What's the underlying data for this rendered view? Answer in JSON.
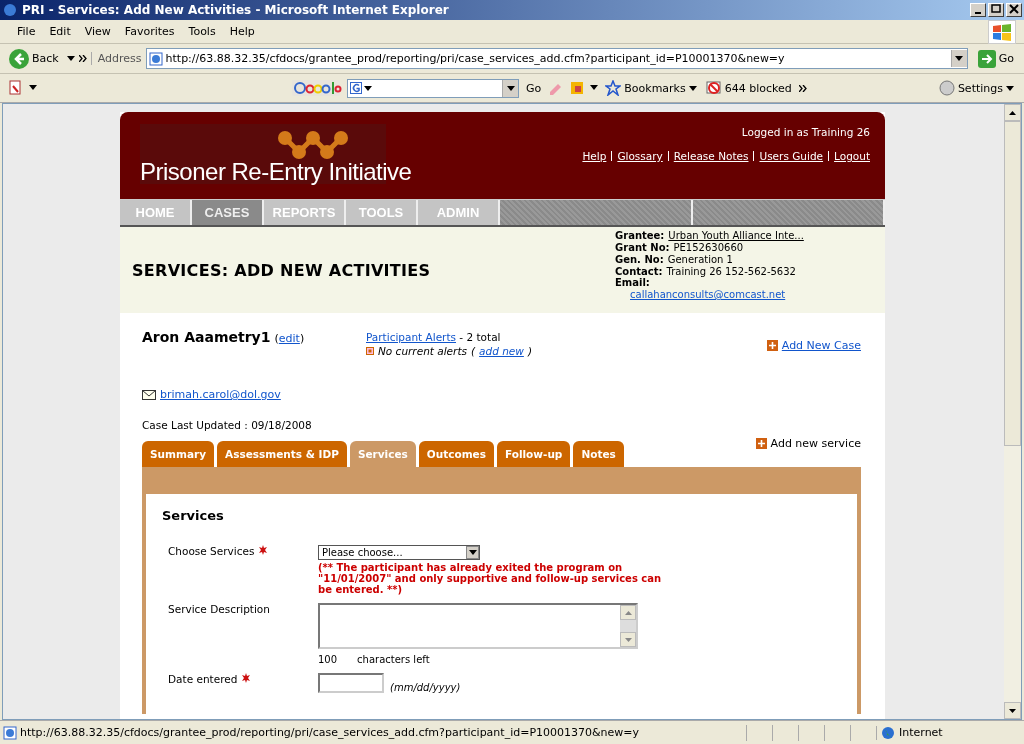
{
  "window": {
    "title": "PRI - Services: Add New Activities - Microsoft Internet Explorer"
  },
  "menu_bar": [
    "File",
    "Edit",
    "View",
    "Favorites",
    "Tools",
    "Help"
  ],
  "address_bar": {
    "back": "Back",
    "label": "Address",
    "url": "http://63.88.32.35/cfdocs/grantee_prod/reporting/pri/case_services_add.cfm?participant_id=P10001370&new=y",
    "go": "Go"
  },
  "google_toolbar": {
    "go": "Go",
    "bookmarks": "Bookmarks",
    "blocked": "644 blocked",
    "settings": "Settings"
  },
  "page": {
    "logo_text": "Prisoner Re-Entry Initiative",
    "logged_in": "Logged in as Training 26",
    "header_links": [
      "Help",
      "Glossary",
      "Release Notes",
      "Users Guide",
      "Logout"
    ],
    "nav_tabs": [
      {
        "label": "HOME",
        "selected": false
      },
      {
        "label": "CASES",
        "selected": true
      },
      {
        "label": "REPORTS",
        "selected": false
      },
      {
        "label": "TOOLS",
        "selected": false
      },
      {
        "label": "ADMIN",
        "selected": false
      }
    ],
    "heading": "SERVICES: ADD NEW ACTIVITIES",
    "grant_info": [
      {
        "label": "Grantee:",
        "value": "Urban Youth Alliance Inte...",
        "kind": "link"
      },
      {
        "label": "Grant No:",
        "value": "PE152630660",
        "kind": "text"
      },
      {
        "label": "Gen. No:",
        "value": "Generation 1",
        "kind": "text"
      },
      {
        "label": "Contact:",
        "value": "Training 26  152-562-5632",
        "kind": "text"
      },
      {
        "label": "Email:",
        "value": "callahanconsults@comcast.net",
        "kind": "email"
      }
    ],
    "participant": {
      "name": "Aron Aaametry1",
      "edit_open": "(",
      "edit": "edit",
      "edit_close": ")",
      "alerts_link": "Participant Alerts",
      "alerts_total": "- 2 total",
      "no_alerts": "No current alerts",
      "add_new_open": "(",
      "add_new": "add new",
      "add_new_close": ")",
      "add_case": "Add New Case",
      "email": "brimah.carol@dol.gov",
      "last_updated": "Case Last Updated : 09/18/2008"
    },
    "case_tabs": [
      {
        "label": "Summary",
        "selected": false
      },
      {
        "label": "Assessments & IDP",
        "selected": false
      },
      {
        "label": "Services",
        "selected": true
      },
      {
        "label": "Outcomes",
        "selected": false
      },
      {
        "label": "Follow-up",
        "selected": false
      },
      {
        "label": "Notes",
        "selected": false
      }
    ],
    "add_service": "Add new service",
    "form": {
      "title": "Services",
      "fields": [
        {
          "kind": "select",
          "label": "Choose Services",
          "required": true,
          "value": "Please choose...",
          "warning": "(** The participant has already exited the program on \"11/01/2007\" and only supportive and follow-up services can be entered. **)"
        },
        {
          "kind": "textarea",
          "label": "Service Description",
          "required": false,
          "count": "100",
          "count_label": "characters left"
        },
        {
          "kind": "date",
          "label": "Date entered",
          "required": true,
          "hint": "(mm/dd/yyyy)"
        }
      ]
    }
  },
  "status_bar": {
    "url": "http://63.88.32.35/cfdocs/grantee_prod/reporting/pri/case_services_add.cfm?participant_id=P10001370&new=y",
    "zone": "Internet"
  }
}
